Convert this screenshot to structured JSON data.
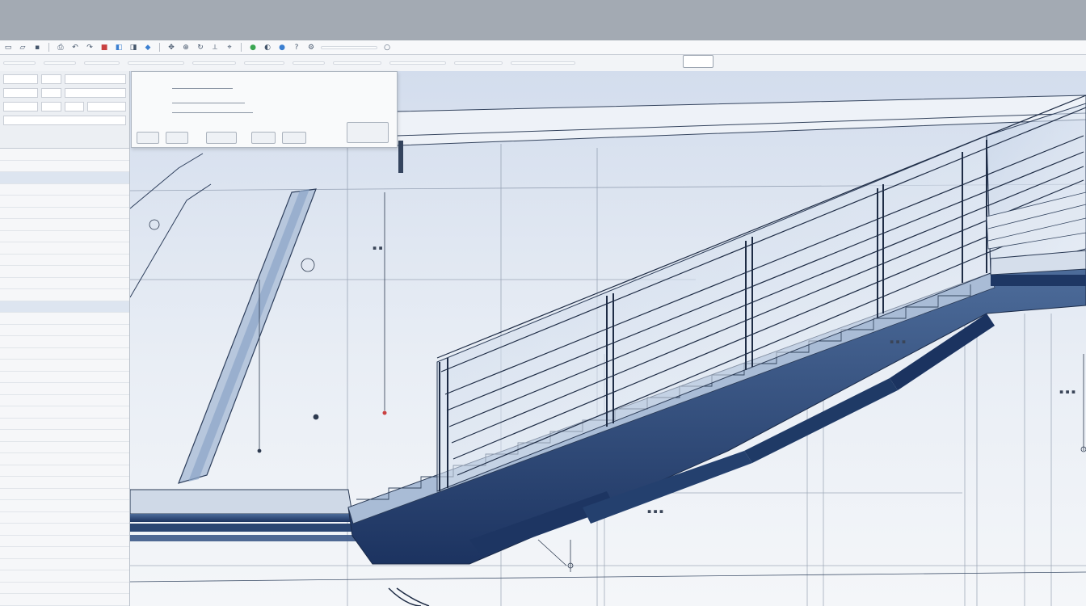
{
  "toolbar": {
    "icons": [
      "new-icon",
      "open-icon",
      "save-icon",
      "print-icon",
      "undo-icon",
      "redo-icon",
      "cut-icon",
      "copy-icon",
      "paste-icon",
      "match-icon",
      "pan-icon",
      "zoom-icon",
      "rotate-icon",
      "measure-icon",
      "snap-icon",
      "layer-icon",
      "render-icon",
      "help-icon",
      "globe-icon",
      "settings-icon",
      "search-icon"
    ],
    "accent": "#c94040",
    "green": "#3aa652",
    "blue": "#3b7fd1"
  },
  "viewport": {
    "background_top": "#d6e0ec",
    "background_bottom": "#f2f5f9",
    "steel_dark": "#1f3863",
    "steel_mid": "#5c7aa8",
    "line": "#3c4b63"
  }
}
